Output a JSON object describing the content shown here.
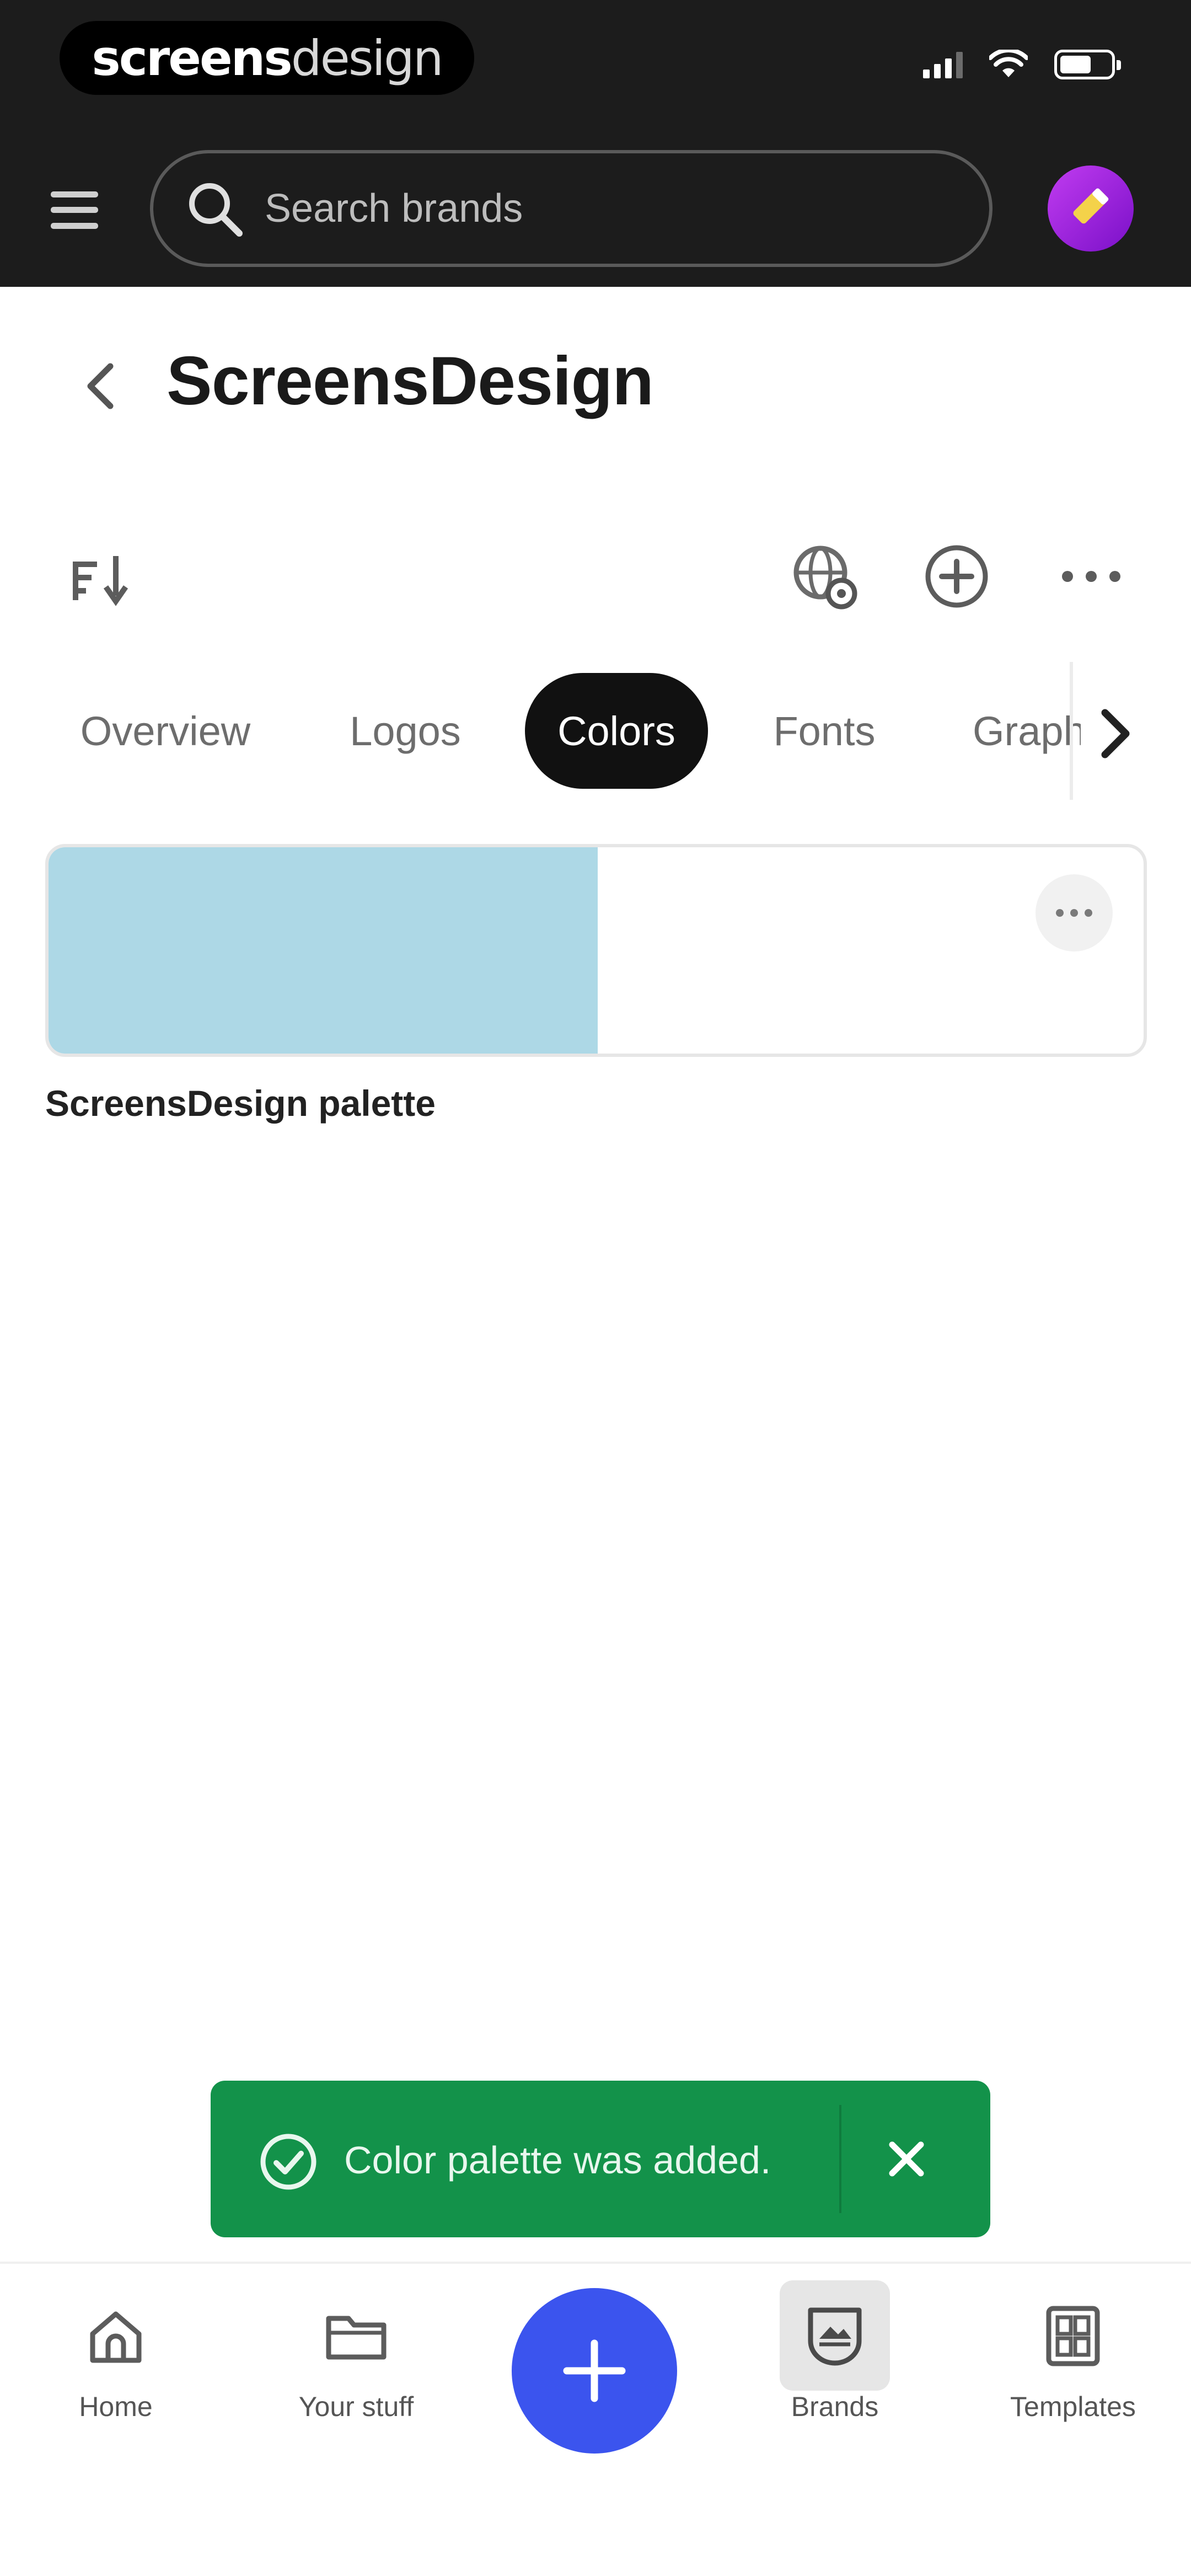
{
  "watermark": {
    "bold": "screens",
    "light": "design"
  },
  "header": {
    "search_placeholder": "Search brands"
  },
  "brand": {
    "title": "ScreensDesign"
  },
  "tabs": [
    {
      "label": "Overview",
      "active": false
    },
    {
      "label": "Logos",
      "active": false
    },
    {
      "label": "Colors",
      "active": true
    },
    {
      "label": "Fonts",
      "active": false
    },
    {
      "label": "Graph",
      "active": false
    }
  ],
  "palette": {
    "name": "ScreensDesign palette",
    "colors": [
      "#add8e6",
      "#ffffff"
    ]
  },
  "toast": {
    "message": "Color palette was added."
  },
  "nav": {
    "items": [
      {
        "label": "Home",
        "icon": "home-icon"
      },
      {
        "label": "Your stuff",
        "icon": "folder-icon"
      },
      {
        "label": "Brands",
        "icon": "brand-shield-icon"
      },
      {
        "label": "Templates",
        "icon": "templates-icon"
      }
    ],
    "fab_icon": "plus-icon"
  },
  "colors": {
    "header_bg": "#1c1c1c",
    "active_tab": "#111111",
    "toast_bg": "#13924a",
    "fab": "#3b54ee"
  }
}
